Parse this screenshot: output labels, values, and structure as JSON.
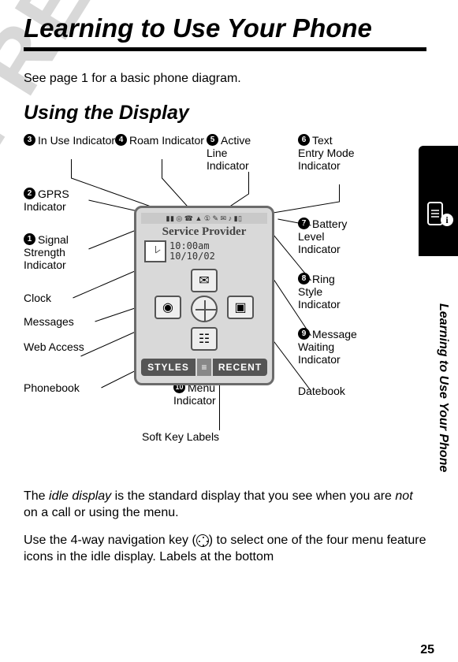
{
  "title": "Learning to Use Your Phone",
  "intro": "See page 1 for a basic phone diagram.",
  "section": "Using the Display",
  "watermark": "PRELIMINARY",
  "sidetext": "Learning to Use Your Phone",
  "pagenum": "25",
  "callouts": {
    "c1": "Signal Strength Indicator",
    "c2": "GPRS Indicator",
    "c3": "In Use Indicator",
    "c4": "Roam Indicator",
    "c5": "Active Line Indicator",
    "c6": "Text Entry Mode Indicator",
    "c7": "Battery Level Indicator",
    "c8": "Ring Style Indicator",
    "c9": "Message Waiting Indicator",
    "c10": "Menu Indicator",
    "clock": "Clock",
    "messages": "Messages",
    "web": "Web Access",
    "phonebook": "Phonebook",
    "datebook": "Datebook",
    "softkeys": "Soft Key Labels"
  },
  "screen": {
    "provider": "Service Provider",
    "time": "10:00am",
    "date": "10/10/02",
    "soft_left": "STYLES",
    "soft_right": "RECENT",
    "menu_glyph": "≡"
  },
  "body1a": "The ",
  "body1b": "idle display",
  "body1c": " is the standard display that you see when you are ",
  "body1d": "not",
  "body1e": " on a call or using the menu.",
  "body2a": "Use the 4-way navigation key (",
  "body2b": ") to select one of the four menu feature icons in the idle display. Labels at the bottom"
}
